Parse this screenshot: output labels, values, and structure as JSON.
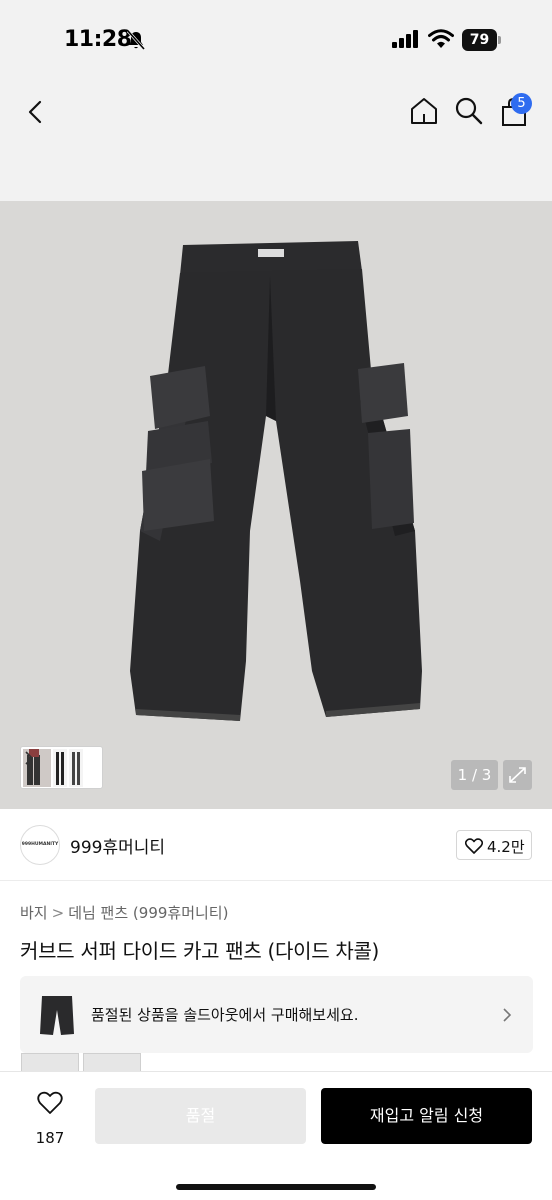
{
  "status_bar": {
    "time": "11:28",
    "battery": "79",
    "icons": [
      "bell-slash-icon",
      "cellular-signal-icon",
      "wifi-icon",
      "battery-icon"
    ]
  },
  "nav": {
    "icons": [
      "back-chevron-icon",
      "home-icon",
      "search-icon",
      "shopping-bag-icon"
    ],
    "cart_count": "5"
  },
  "gallery": {
    "page": "1 / 3",
    "icons": [
      "chevron-right-icon",
      "expand-icon"
    ]
  },
  "brand": {
    "logo_text": "999HUMANITY",
    "name": "999휴머니티",
    "likes": "4.2만"
  },
  "breadcrumb": {
    "items": [
      "바지",
      "데님 팬츠 (999휴머니티)"
    ],
    "separator": ">"
  },
  "product": {
    "title": "커브드 서퍼 다이드 카고 팬츠 (다이드 차콜)"
  },
  "soldout_banner": {
    "text": "품절된 상품을 솔드아웃에서 구매해보세요."
  },
  "bottom_bar": {
    "like_count": "187",
    "soldout_label": "품절",
    "restock_label": "재입고 알림 신청"
  },
  "colors": {
    "accent_badge": "#2f6cf0",
    "primary_button": "#000000",
    "disabled_button": "#e9e9e9",
    "hero_bg": "#d9d8d6"
  }
}
